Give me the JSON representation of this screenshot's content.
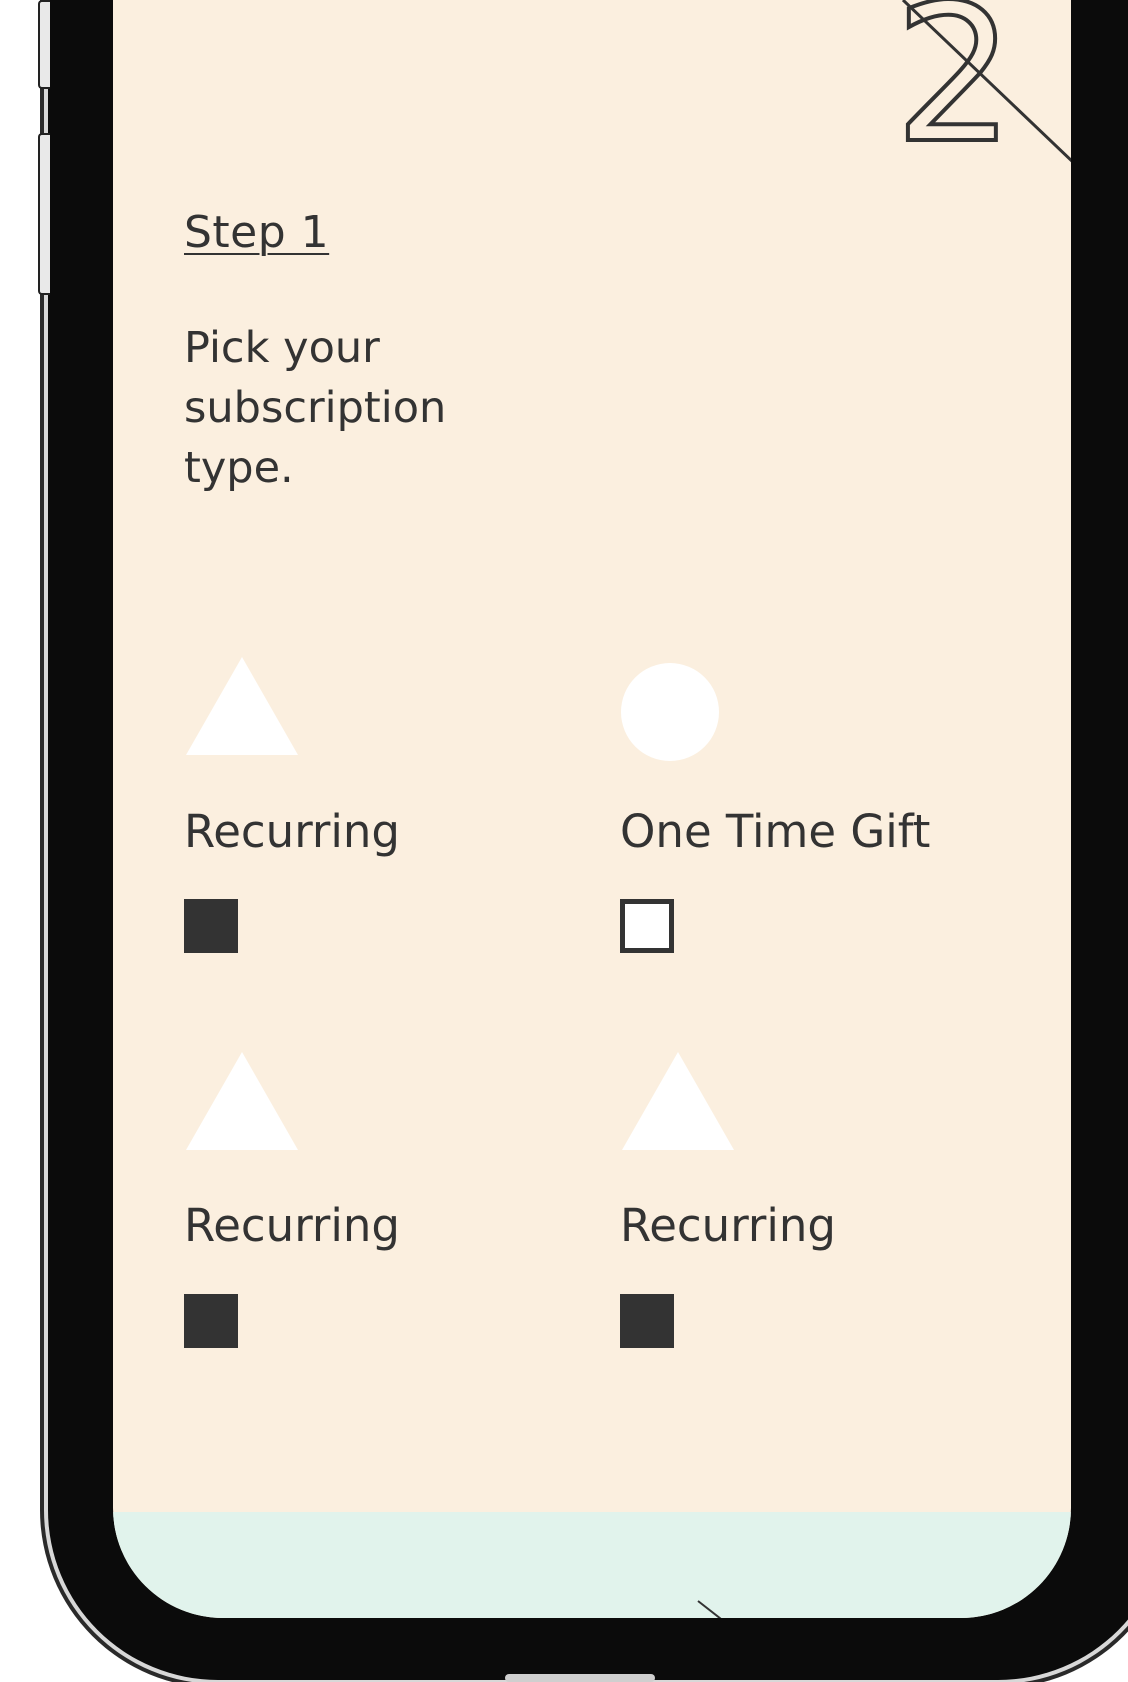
{
  "step": {
    "label": "Step 1",
    "heading": "Pick your subscription type."
  },
  "options": [
    {
      "label": "Recurring",
      "shape": "triangle-icon",
      "checked": true
    },
    {
      "label": "One Time Gift",
      "shape": "circle-icon",
      "checked": false
    },
    {
      "label": "Recurring",
      "shape": "triangle-icon",
      "checked": true
    },
    {
      "label": "Recurring",
      "shape": "triangle-icon",
      "checked": true
    }
  ],
  "colors": {
    "background": "#fbefdf",
    "footer_band": "#e1f3ec",
    "text": "#333333",
    "shape_fill": "#ffffff"
  },
  "decoration": {
    "glyph": "2"
  }
}
